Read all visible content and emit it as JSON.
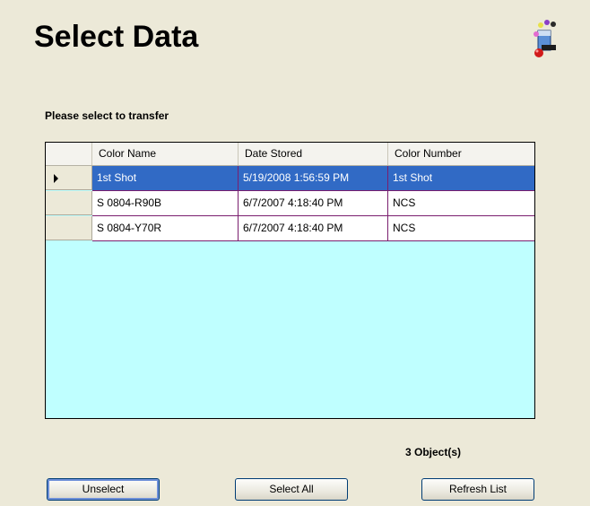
{
  "title": "Select Data",
  "subtitle": "Please select to transfer",
  "icon": "app-paint-icon",
  "table": {
    "columns": [
      "Color Name",
      "Date Stored",
      "Color Number"
    ],
    "rows": [
      {
        "color_name": "1st Shot",
        "date_stored": "5/19/2008 1:56:59 PM",
        "color_number": "1st Shot",
        "selected": true
      },
      {
        "color_name": "S 0804-R90B",
        "date_stored": "6/7/2007 4:18:40 PM",
        "color_number": "NCS",
        "selected": false
      },
      {
        "color_name": "S 0804-Y70R",
        "date_stored": "6/7/2007 4:18:40 PM",
        "color_number": "NCS",
        "selected": false
      }
    ]
  },
  "object_count": "3 Object(s)",
  "buttons": {
    "unselect": "Unselect",
    "select_all": "Select All",
    "refresh_list": "Refresh List"
  },
  "colors": {
    "background": "#ece9d8",
    "grid_empty": "#bfffff",
    "selection": "#316ac5",
    "grid_lines": "#7a1e6e"
  }
}
